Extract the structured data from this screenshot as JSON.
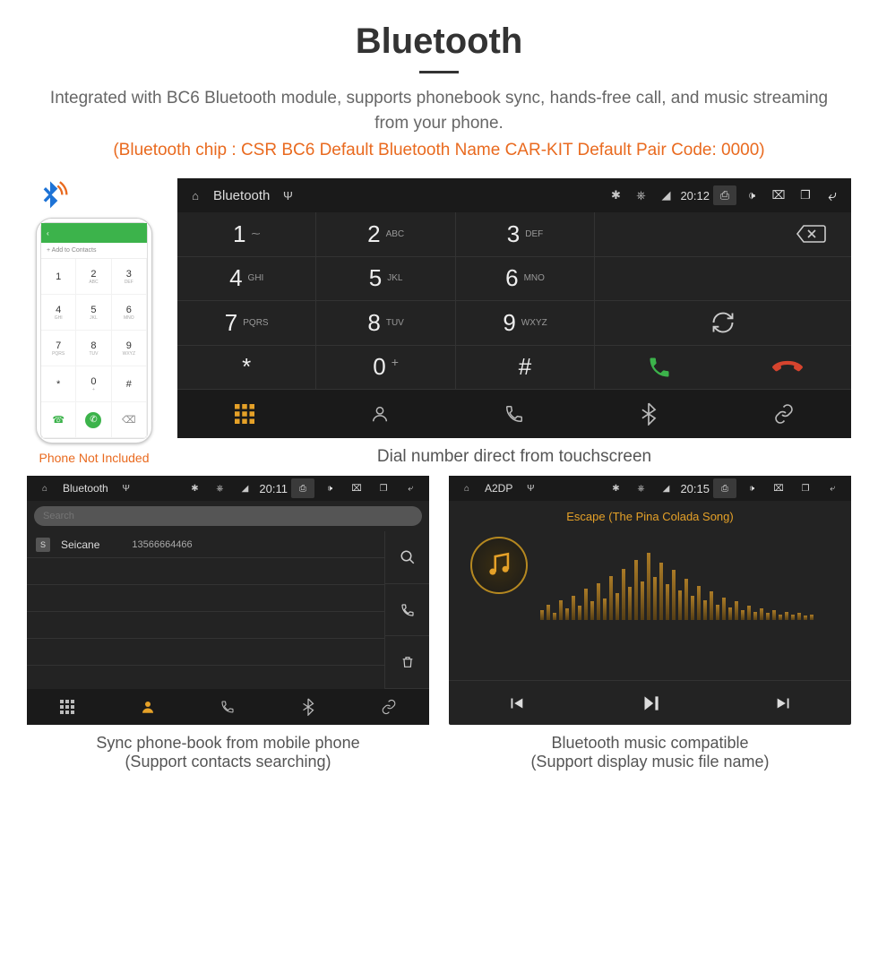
{
  "header": {
    "title": "Bluetooth",
    "desc": "Integrated with BC6 Bluetooth module, supports phonebook sync, hands-free call, and music streaming from your phone.",
    "spec": "(Bluetooth chip : CSR BC6    Default Bluetooth Name CAR-KIT    Default Pair Code: 0000)"
  },
  "phone": {
    "add_contact": "+  Add to Contacts",
    "keys": [
      {
        "d": "1",
        "s": ""
      },
      {
        "d": "2",
        "s": "ABC"
      },
      {
        "d": "3",
        "s": "DEF"
      },
      {
        "d": "4",
        "s": "GHI"
      },
      {
        "d": "5",
        "s": "JKL"
      },
      {
        "d": "6",
        "s": "MNO"
      },
      {
        "d": "7",
        "s": "PQRS"
      },
      {
        "d": "8",
        "s": "TUV"
      },
      {
        "d": "9",
        "s": "WXYZ"
      },
      {
        "d": "*",
        "s": ""
      },
      {
        "d": "0",
        "s": "+"
      },
      {
        "d": "#",
        "s": ""
      }
    ],
    "caption": "Phone Not Included"
  },
  "main_dialer": {
    "topbar": {
      "title": "Bluetooth",
      "time": "20:12"
    },
    "keys": [
      {
        "d": "1",
        "s": "⁓"
      },
      {
        "d": "2",
        "s": "ABC"
      },
      {
        "d": "3",
        "s": "DEF"
      },
      {
        "d": "4",
        "s": "GHI"
      },
      {
        "d": "5",
        "s": "JKL"
      },
      {
        "d": "6",
        "s": "MNO"
      },
      {
        "d": "7",
        "s": "PQRS"
      },
      {
        "d": "8",
        "s": "TUV"
      },
      {
        "d": "9",
        "s": "WXYZ"
      },
      {
        "d": "*",
        "s": ""
      },
      {
        "d": "0",
        "s": "",
        "sup": "+"
      },
      {
        "d": "#",
        "s": ""
      }
    ],
    "caption": "Dial number direct from touchscreen"
  },
  "phonebook": {
    "topbar": {
      "title": "Bluetooth",
      "time": "20:11"
    },
    "search_placeholder": "Search",
    "contact": {
      "initial": "S",
      "name": "Seicane",
      "number": "13566664466"
    },
    "caption_line1": "Sync phone-book from mobile phone",
    "caption_line2": "(Support contacts searching)"
  },
  "music": {
    "topbar": {
      "title": "A2DP",
      "time": "20:15"
    },
    "track": "Escape (The Pina Colada Song)",
    "caption_line1": "Bluetooth music compatible",
    "caption_line2": "(Support display music file name)"
  },
  "colors": {
    "accent": "#e96a1f",
    "gold": "#e5a128",
    "green": "#3cb34b",
    "red": "#d6442e"
  }
}
